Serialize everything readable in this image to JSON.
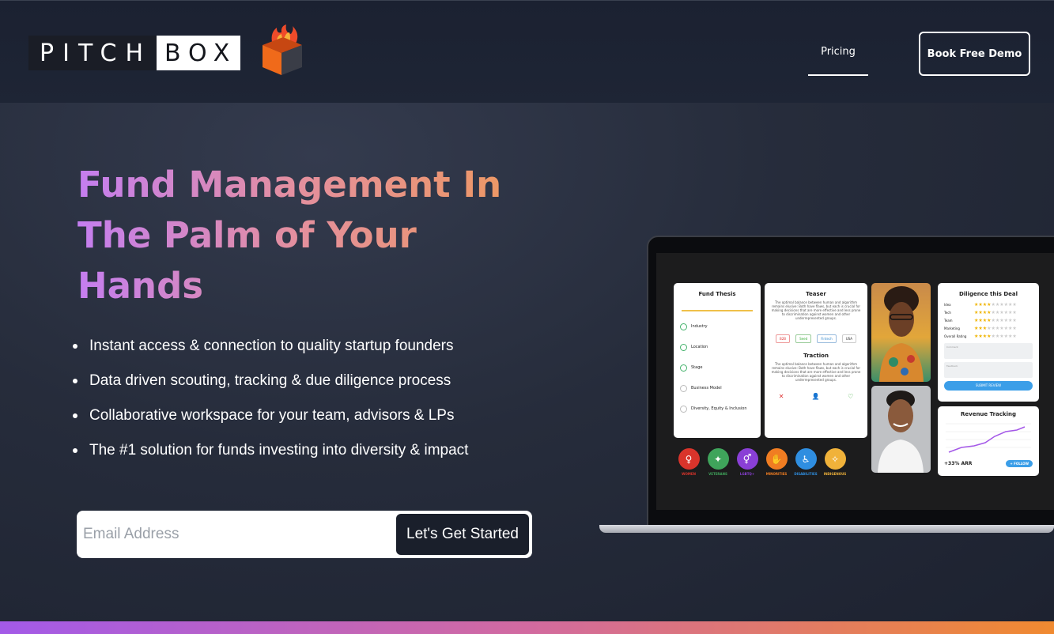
{
  "brand": {
    "part1": "PITCH",
    "part2": "BOX"
  },
  "nav": {
    "pricing": "Pricing",
    "demo": "Book Free Demo"
  },
  "hero": {
    "headline": "Fund Management In The Palm of Your Hands",
    "bullets": [
      "Instant access & connection to quality startup founders",
      "Data driven scouting, tracking & due diligence process",
      "Collaborative workspace for your team, advisors & LPs",
      "The #1 solution for funds investing into diversity & impact"
    ],
    "email_placeholder": "Email Address",
    "cta": "Let's Get Started"
  },
  "mockup": {
    "thesis": {
      "title": "Fund Thesis",
      "rows": [
        "Industry",
        "Location",
        "Stage",
        "Business Model",
        "Diversity, Equity & Inclusion"
      ]
    },
    "teaser": {
      "title": "Teaser",
      "text": "The optimal balance between human and algorithm remains elusive: Both have flaws, but each is crucial for making decisions that are more effective and less prone to discrimination against women and other underrepresented groups.",
      "tags": [
        "B2B",
        "Seed",
        "Fintech",
        "USA"
      ]
    },
    "traction": {
      "title": "Traction",
      "text": "The optimal balance between human and algorithm remains elusive: Both have flaws, but each is crucial for making decisions that are more effective and less prone to discrimination against women and other underrepresented groups."
    },
    "diligence": {
      "title": "Diligence this Deal",
      "rows": [
        {
          "label": "Idea",
          "stars": 4
        },
        {
          "label": "Tech",
          "stars": 4
        },
        {
          "label": "Team",
          "stars": 4
        },
        {
          "label": "Marketing",
          "stars": 3
        },
        {
          "label": "Overall Rating",
          "stars": 4
        }
      ],
      "field1": "Comment",
      "field2": "Feedback",
      "submit": "SUBMIT REVIEW"
    },
    "revenue": {
      "title": "Revenue Tracking",
      "arr": "+33% ARR",
      "follow": "+ FOLLOW"
    },
    "badges": [
      {
        "label": "WOMEN",
        "color": "#d9342b",
        "icon": "♀"
      },
      {
        "label": "VETERANS",
        "color": "#3fa45b",
        "icon": "✦"
      },
      {
        "label": "LGBTQ+",
        "color": "#8a3fd6",
        "icon": "⚥"
      },
      {
        "label": "MINORITIES",
        "color": "#f07d22",
        "icon": "✋"
      },
      {
        "label": "DISABILITIES",
        "color": "#2f8ee0",
        "icon": "♿"
      },
      {
        "label": "INDIGENOUS",
        "color": "#f0b23a",
        "icon": "✧"
      }
    ]
  }
}
